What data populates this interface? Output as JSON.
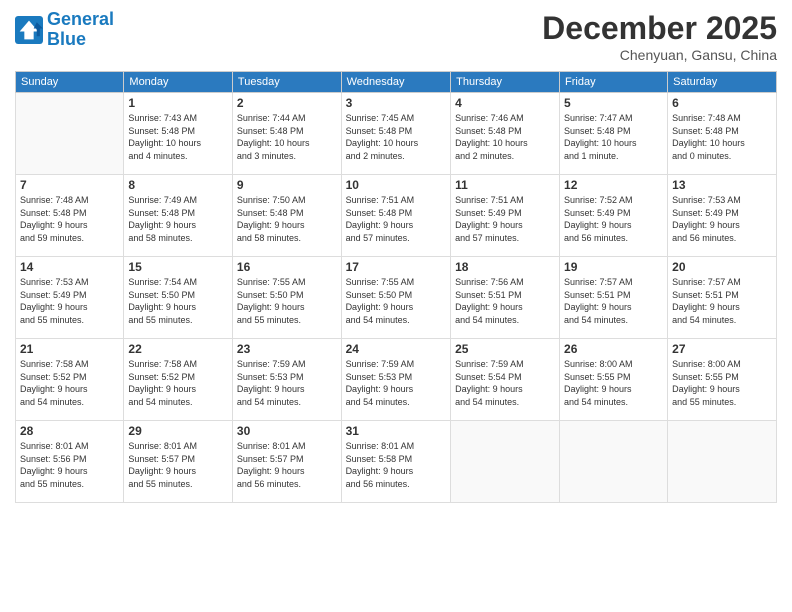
{
  "header": {
    "logo_line1": "General",
    "logo_line2": "Blue",
    "month": "December 2025",
    "location": "Chenyuan, Gansu, China"
  },
  "weekdays": [
    "Sunday",
    "Monday",
    "Tuesday",
    "Wednesday",
    "Thursday",
    "Friday",
    "Saturday"
  ],
  "weeks": [
    [
      {
        "day": "",
        "info": ""
      },
      {
        "day": "1",
        "info": "Sunrise: 7:43 AM\nSunset: 5:48 PM\nDaylight: 10 hours\nand 4 minutes."
      },
      {
        "day": "2",
        "info": "Sunrise: 7:44 AM\nSunset: 5:48 PM\nDaylight: 10 hours\nand 3 minutes."
      },
      {
        "day": "3",
        "info": "Sunrise: 7:45 AM\nSunset: 5:48 PM\nDaylight: 10 hours\nand 2 minutes."
      },
      {
        "day": "4",
        "info": "Sunrise: 7:46 AM\nSunset: 5:48 PM\nDaylight: 10 hours\nand 2 minutes."
      },
      {
        "day": "5",
        "info": "Sunrise: 7:47 AM\nSunset: 5:48 PM\nDaylight: 10 hours\nand 1 minute."
      },
      {
        "day": "6",
        "info": "Sunrise: 7:48 AM\nSunset: 5:48 PM\nDaylight: 10 hours\nand 0 minutes."
      }
    ],
    [
      {
        "day": "7",
        "info": "Sunrise: 7:48 AM\nSunset: 5:48 PM\nDaylight: 9 hours\nand 59 minutes."
      },
      {
        "day": "8",
        "info": "Sunrise: 7:49 AM\nSunset: 5:48 PM\nDaylight: 9 hours\nand 58 minutes."
      },
      {
        "day": "9",
        "info": "Sunrise: 7:50 AM\nSunset: 5:48 PM\nDaylight: 9 hours\nand 58 minutes."
      },
      {
        "day": "10",
        "info": "Sunrise: 7:51 AM\nSunset: 5:48 PM\nDaylight: 9 hours\nand 57 minutes."
      },
      {
        "day": "11",
        "info": "Sunrise: 7:51 AM\nSunset: 5:49 PM\nDaylight: 9 hours\nand 57 minutes."
      },
      {
        "day": "12",
        "info": "Sunrise: 7:52 AM\nSunset: 5:49 PM\nDaylight: 9 hours\nand 56 minutes."
      },
      {
        "day": "13",
        "info": "Sunrise: 7:53 AM\nSunset: 5:49 PM\nDaylight: 9 hours\nand 56 minutes."
      }
    ],
    [
      {
        "day": "14",
        "info": "Sunrise: 7:53 AM\nSunset: 5:49 PM\nDaylight: 9 hours\nand 55 minutes."
      },
      {
        "day": "15",
        "info": "Sunrise: 7:54 AM\nSunset: 5:50 PM\nDaylight: 9 hours\nand 55 minutes."
      },
      {
        "day": "16",
        "info": "Sunrise: 7:55 AM\nSunset: 5:50 PM\nDaylight: 9 hours\nand 55 minutes."
      },
      {
        "day": "17",
        "info": "Sunrise: 7:55 AM\nSunset: 5:50 PM\nDaylight: 9 hours\nand 54 minutes."
      },
      {
        "day": "18",
        "info": "Sunrise: 7:56 AM\nSunset: 5:51 PM\nDaylight: 9 hours\nand 54 minutes."
      },
      {
        "day": "19",
        "info": "Sunrise: 7:57 AM\nSunset: 5:51 PM\nDaylight: 9 hours\nand 54 minutes."
      },
      {
        "day": "20",
        "info": "Sunrise: 7:57 AM\nSunset: 5:51 PM\nDaylight: 9 hours\nand 54 minutes."
      }
    ],
    [
      {
        "day": "21",
        "info": "Sunrise: 7:58 AM\nSunset: 5:52 PM\nDaylight: 9 hours\nand 54 minutes."
      },
      {
        "day": "22",
        "info": "Sunrise: 7:58 AM\nSunset: 5:52 PM\nDaylight: 9 hours\nand 54 minutes."
      },
      {
        "day": "23",
        "info": "Sunrise: 7:59 AM\nSunset: 5:53 PM\nDaylight: 9 hours\nand 54 minutes."
      },
      {
        "day": "24",
        "info": "Sunrise: 7:59 AM\nSunset: 5:53 PM\nDaylight: 9 hours\nand 54 minutes."
      },
      {
        "day": "25",
        "info": "Sunrise: 7:59 AM\nSunset: 5:54 PM\nDaylight: 9 hours\nand 54 minutes."
      },
      {
        "day": "26",
        "info": "Sunrise: 8:00 AM\nSunset: 5:55 PM\nDaylight: 9 hours\nand 54 minutes."
      },
      {
        "day": "27",
        "info": "Sunrise: 8:00 AM\nSunset: 5:55 PM\nDaylight: 9 hours\nand 55 minutes."
      }
    ],
    [
      {
        "day": "28",
        "info": "Sunrise: 8:01 AM\nSunset: 5:56 PM\nDaylight: 9 hours\nand 55 minutes."
      },
      {
        "day": "29",
        "info": "Sunrise: 8:01 AM\nSunset: 5:57 PM\nDaylight: 9 hours\nand 55 minutes."
      },
      {
        "day": "30",
        "info": "Sunrise: 8:01 AM\nSunset: 5:57 PM\nDaylight: 9 hours\nand 56 minutes."
      },
      {
        "day": "31",
        "info": "Sunrise: 8:01 AM\nSunset: 5:58 PM\nDaylight: 9 hours\nand 56 minutes."
      },
      {
        "day": "",
        "info": ""
      },
      {
        "day": "",
        "info": ""
      },
      {
        "day": "",
        "info": ""
      }
    ]
  ]
}
